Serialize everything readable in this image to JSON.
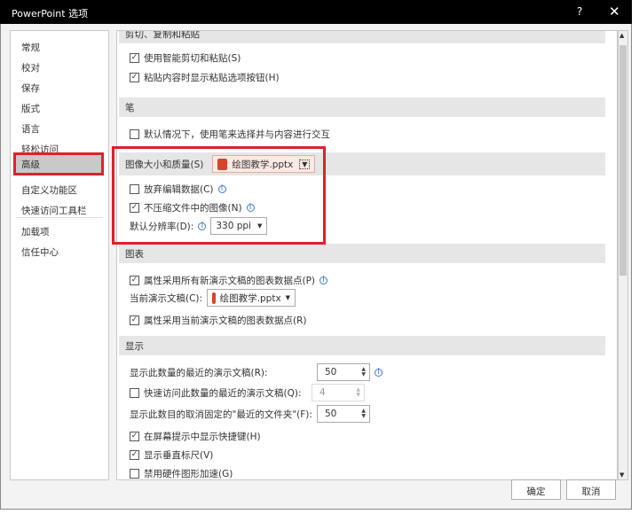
{
  "window": {
    "title": "PowerPoint 选项",
    "help": "?",
    "close": "✕"
  },
  "sidebar": {
    "items": [
      {
        "label": "常规"
      },
      {
        "label": "校对"
      },
      {
        "label": "保存"
      },
      {
        "label": "版式"
      },
      {
        "label": "语言"
      },
      {
        "label": "轻松访问"
      },
      {
        "label": "高级"
      },
      {
        "label": "自定义功能区"
      },
      {
        "label": "快速访问工具栏"
      },
      {
        "label": "加载项"
      },
      {
        "label": "信任中心"
      }
    ],
    "selected": "高级"
  },
  "sections": {
    "cut": {
      "title": "剪切、复制和粘贴",
      "items": [
        {
          "label": "使用智能剪切和粘贴(S)",
          "checked": true
        },
        {
          "label": "粘贴内容时显示粘贴选项按钮(H)",
          "checked": true
        }
      ]
    },
    "pen": {
      "title": "笔",
      "items": [
        {
          "label": "默认情况下，使用笔来选择并与内容进行交互",
          "checked": false
        }
      ]
    },
    "image": {
      "title": "图像大小和质量(S)",
      "file": "绘图教学.pptx",
      "items": [
        {
          "label": "放弃编辑数据(C)",
          "checked": false
        },
        {
          "label": "不压缩文件中的图像(N)",
          "checked": true
        }
      ],
      "resolution_label": "默认分辨率(D):",
      "resolution": "330 ppi"
    },
    "chart": {
      "title": "图表",
      "items": [
        {
          "label": "属性采用所有新演示文稿的图表数据点(P)",
          "checked": true
        },
        {
          "label": "属性采用当前演示文稿的图表数据点(R)",
          "checked": true
        }
      ],
      "current_label": "当前演示文稿(C):",
      "current_file": "绘图教学.pptx"
    },
    "display": {
      "title": "显示",
      "recent_label": "显示此数量的最近的演示文稿(R):",
      "recent_value": "50",
      "quick_label": "快速访问此数量的最近的演示文稿(Q):",
      "quick_value": "4",
      "quick_checked": false,
      "folders_label": "显示此数目的取消固定的\"最近的文件夹\"(F):",
      "folders_value": "50",
      "items": [
        {
          "label": "在屏幕提示中显示快捷键(H)",
          "checked": true
        },
        {
          "label": "显示垂直标尺(V)",
          "checked": true
        },
        {
          "label": "禁用硬件图形加速(G)",
          "checked": false
        }
      ]
    }
  },
  "buttons": {
    "ok": "确定",
    "cancel": "取消"
  }
}
